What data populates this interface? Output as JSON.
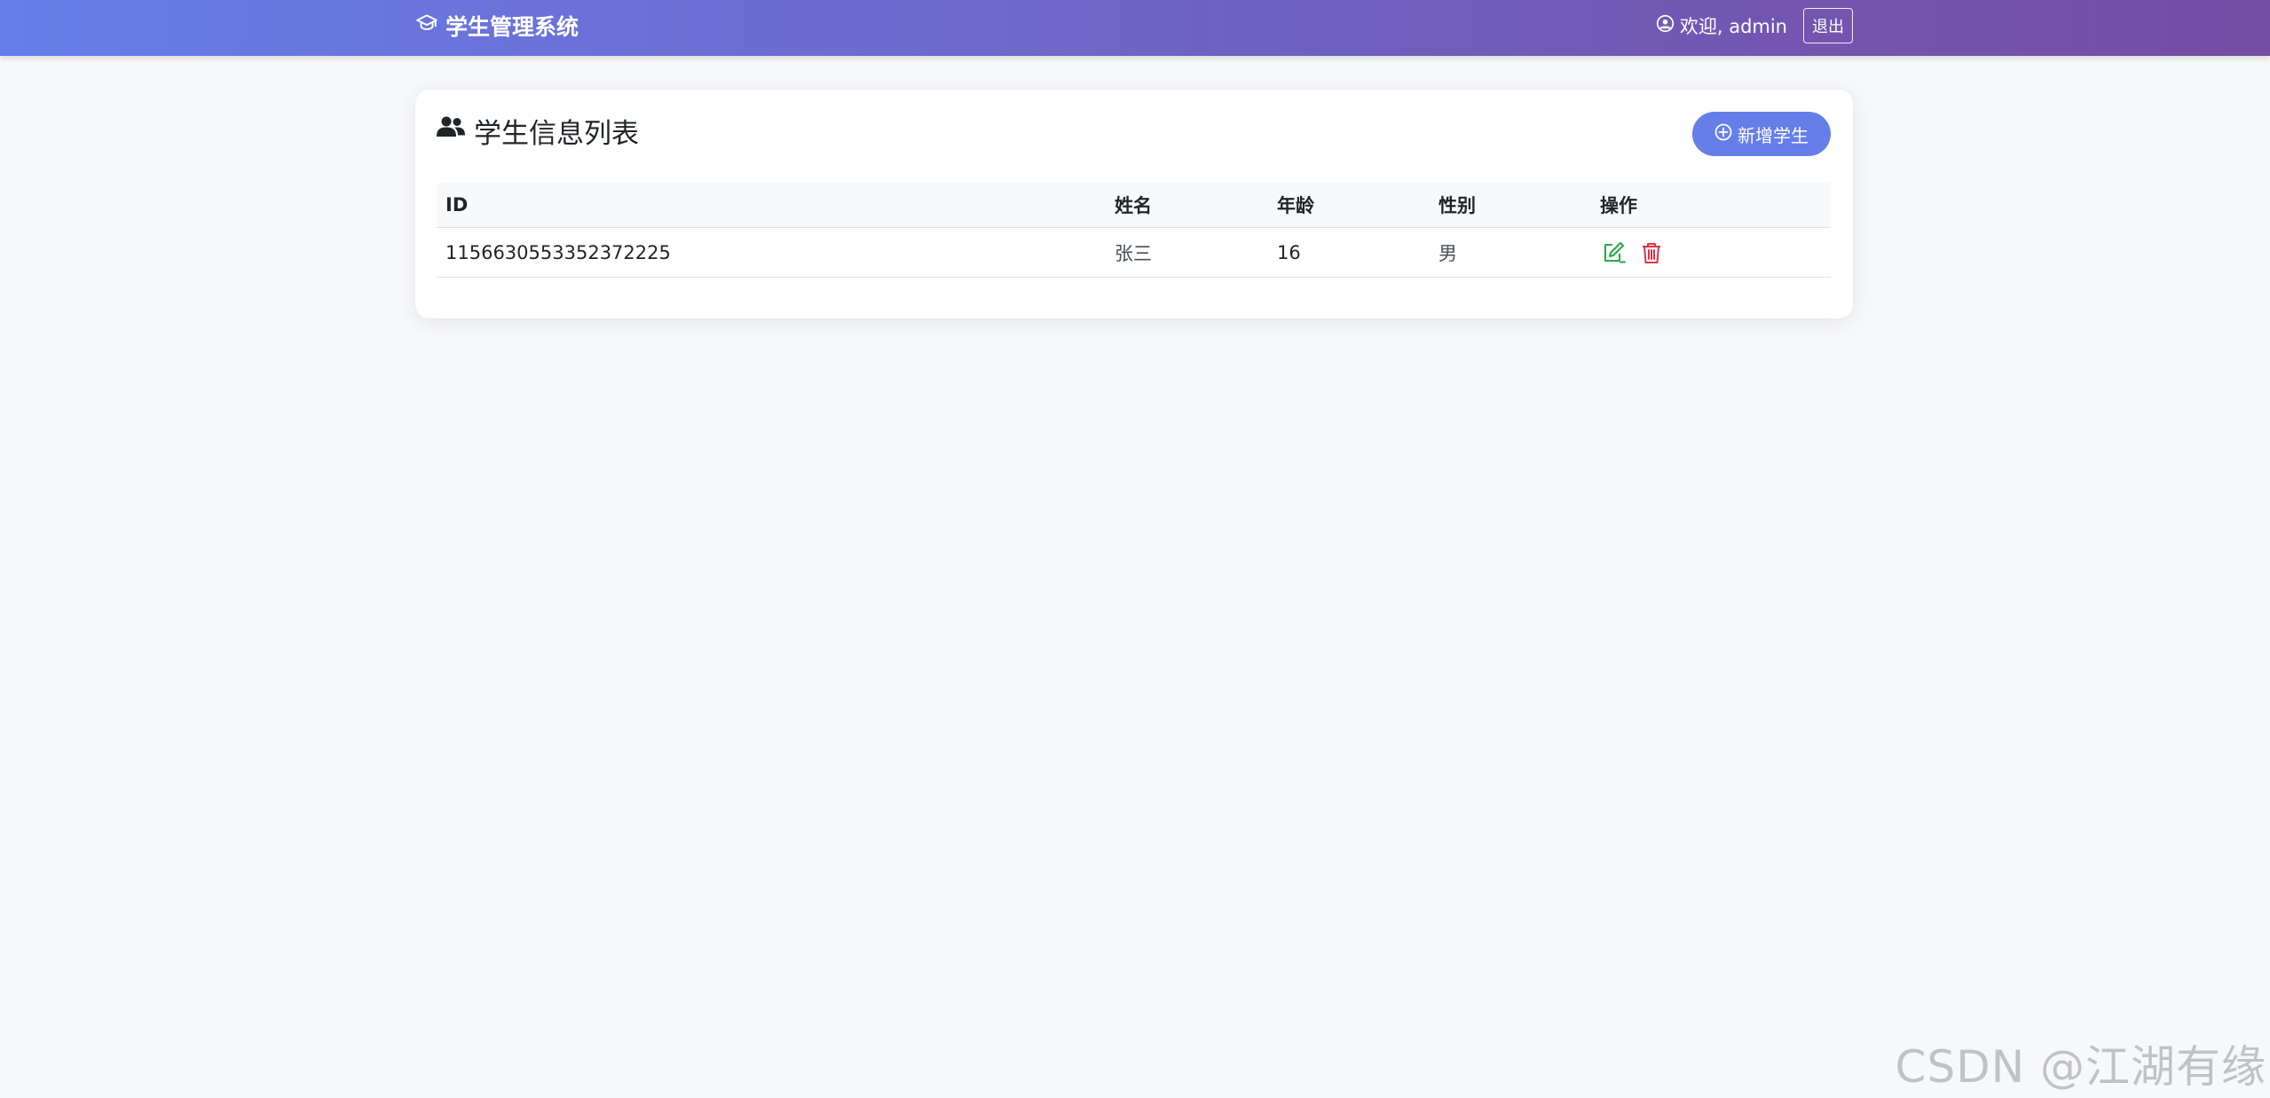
{
  "header": {
    "app_title": "学生管理系统",
    "brand_icon": "graduation-cap-icon",
    "welcome_text": "欢迎, admin",
    "user_icon": "user-circle-icon",
    "logout_label": "退出",
    "gradient_start": "#667eea",
    "gradient_end": "#764ba2"
  },
  "main": {
    "title": "学生信息列表",
    "title_icon": "users-icon",
    "add_button_label": "新增学生",
    "add_button_icon": "plus-circle-icon",
    "accent_color": "#667eea"
  },
  "table": {
    "columns": [
      "ID",
      "姓名",
      "年龄",
      "性别",
      "操作"
    ],
    "rows": [
      {
        "id": "1156630553352372225",
        "name": "张三",
        "age": "16",
        "gender": "男",
        "actions": [
          "edit-icon",
          "delete-icon"
        ]
      }
    ],
    "edit_color": "#28a745",
    "delete_color": "#dc3545"
  },
  "watermark": "CSDN @江湖有缘"
}
